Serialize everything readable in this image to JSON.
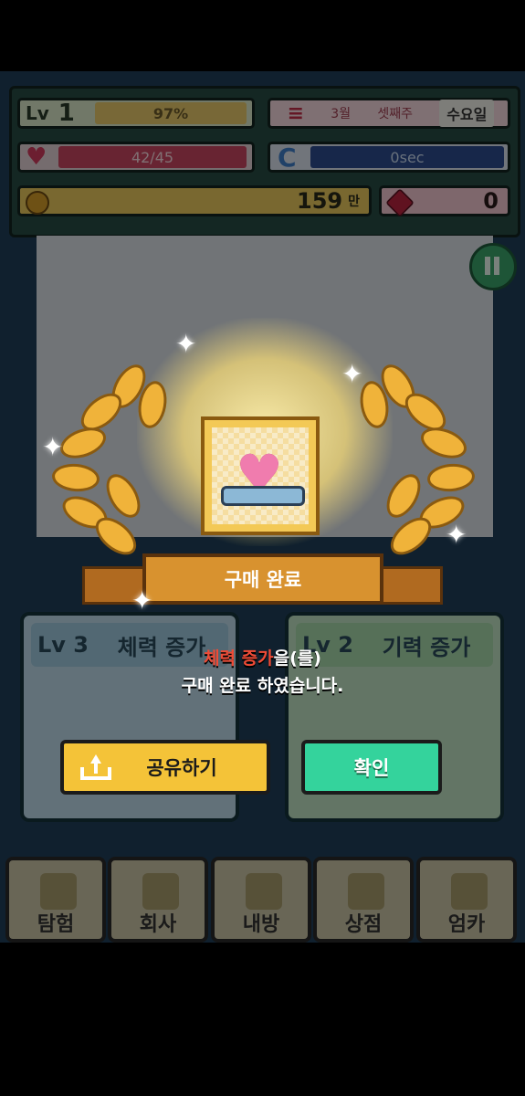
{
  "hud": {
    "level_label": "Lv",
    "level": "1",
    "xp_percent": "97%",
    "date_month": "3월",
    "date_week": "셋째주",
    "date_day": "수요일",
    "hp_text": "42/45",
    "hp_fraction": 0.93,
    "timer_text": "0sec",
    "gold_amount": "159",
    "gold_unit": "만",
    "gems": "0"
  },
  "background_cards": [
    {
      "level": "Lv 3",
      "name": "체력 증가"
    },
    {
      "level": "Lv 2",
      "name": "기력 증가"
    }
  ],
  "bottom_nav": [
    "탐험",
    "회사",
    "내방",
    "상점",
    "엄카"
  ],
  "popup": {
    "ribbon_title": "구매 완료",
    "message_highlight": "체력 증가",
    "message_rest": "을(를)",
    "message_line2": "구매 완료 하였습니다.",
    "share_button": "공유하기",
    "confirm_button": "확인"
  },
  "colors": {
    "highlight": "#ef4b36",
    "confirm": "#34d39c",
    "share": "#f4c338"
  }
}
